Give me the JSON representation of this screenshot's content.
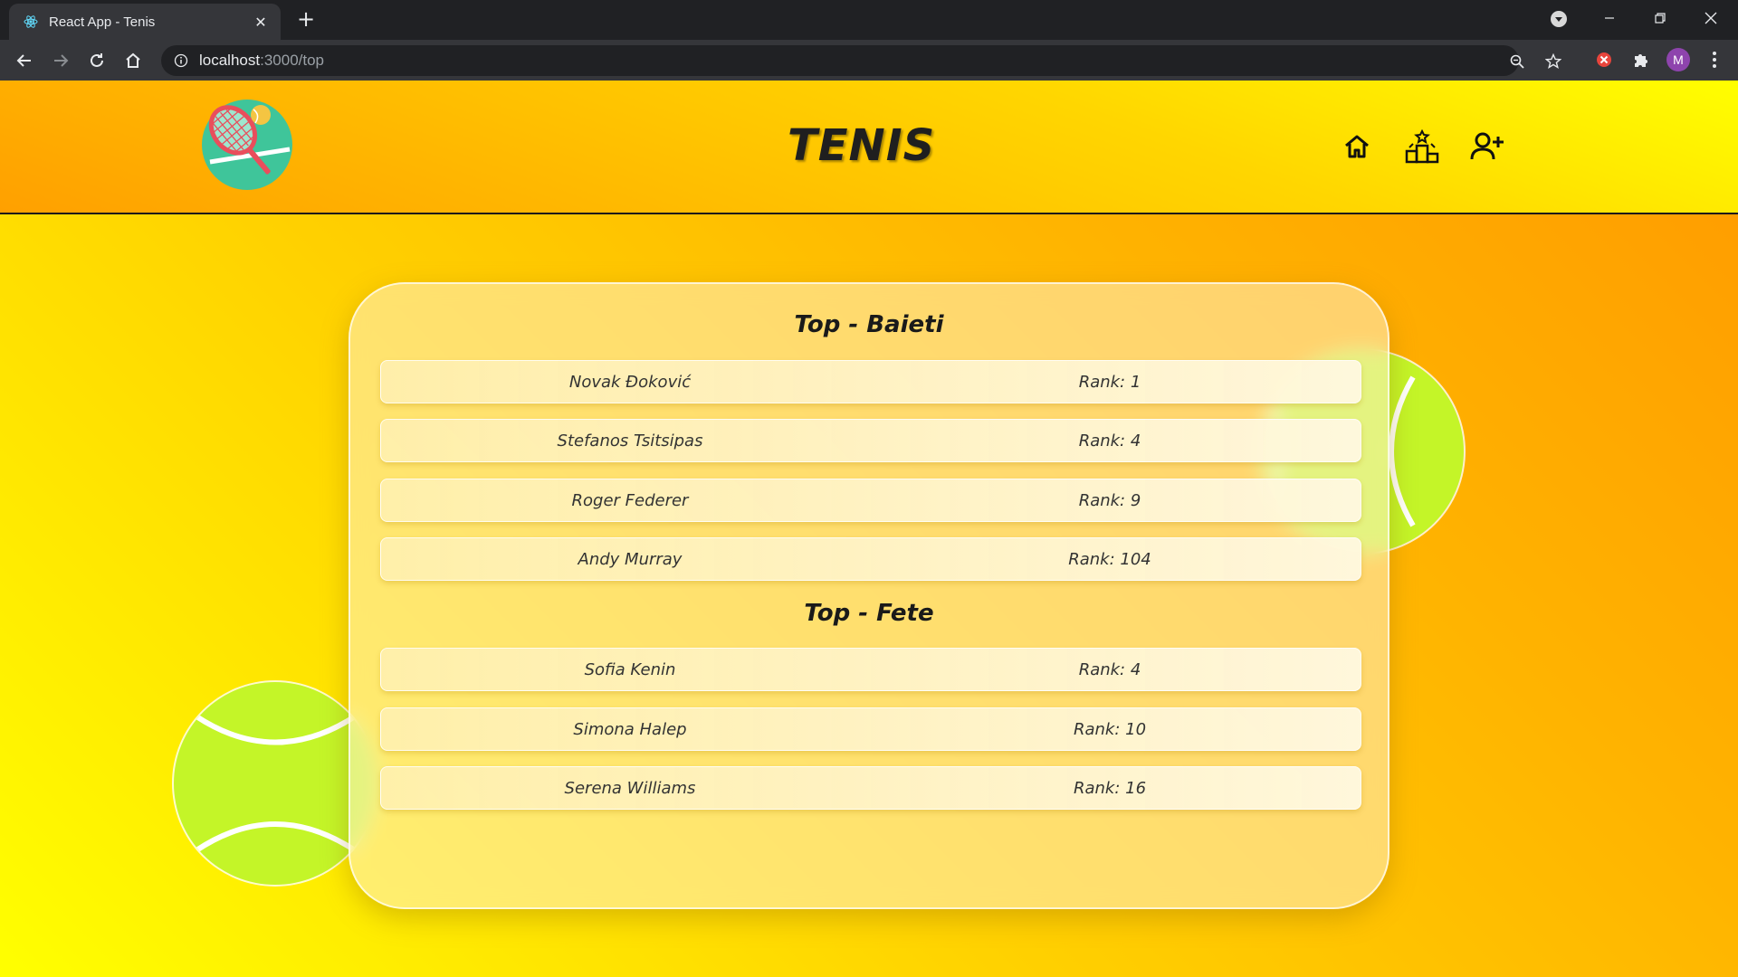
{
  "browser": {
    "tab_title": "React App - Tenis",
    "url_host": "localhost",
    "url_path": ":3000/top",
    "avatar_letter": "M"
  },
  "header": {
    "brand": "TENIS",
    "nav": [
      "home-icon",
      "leaderboard-icon",
      "add-user-icon"
    ]
  },
  "boys": {
    "title": "Top - Baieti",
    "players": [
      {
        "name": "Novak Đoković",
        "rank": "Rank: 1"
      },
      {
        "name": "Stefanos Tsitsipas",
        "rank": "Rank: 4"
      },
      {
        "name": "Roger Federer",
        "rank": "Rank: 9"
      },
      {
        "name": "Andy Murray",
        "rank": "Rank: 104"
      }
    ]
  },
  "girls": {
    "title": "Top - Fete",
    "players": [
      {
        "name": "Sofia Kenin",
        "rank": "Rank: 4"
      },
      {
        "name": "Simona Halep",
        "rank": "Rank: 10"
      },
      {
        "name": "Serena Williams",
        "rank": "Rank: 16"
      }
    ]
  },
  "colors": {
    "accent": "#ffa000",
    "ball": "#c4f528"
  }
}
